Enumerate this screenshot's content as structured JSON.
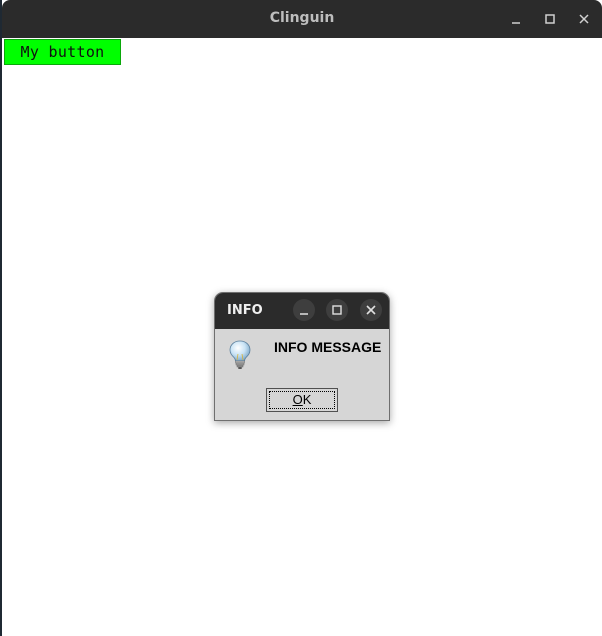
{
  "window": {
    "title": "Clinguin"
  },
  "main": {
    "button_label": "My button"
  },
  "dialog": {
    "title": "INFO",
    "message": "INFO MESSAGE",
    "ok_mnemonic": "O",
    "ok_rest": "K"
  },
  "colors": {
    "button_bg": "#00ff00",
    "titlebar_bg": "#2b2b2b",
    "dialog_bg": "#d6d6d6"
  },
  "icons": {
    "dialog_icon": "lightbulb-icon"
  }
}
